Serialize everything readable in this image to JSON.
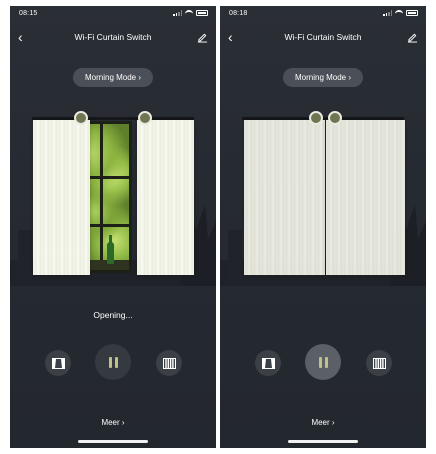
{
  "screens": [
    {
      "status_time": "08:15",
      "nav": {
        "back": "‹",
        "title": "Wi-Fi Curtain Switch"
      },
      "mode_button": "Morning Mode ›",
      "status_text": "Opening...",
      "curtain_state": "partially-open",
      "more_link": "Meer ›"
    },
    {
      "status_time": "08:18",
      "nav": {
        "back": "‹",
        "title": "Wi-Fi Curtain Switch"
      },
      "mode_button": "Morning Mode ›",
      "status_text": "",
      "curtain_state": "closed",
      "more_link": "Meer ›"
    }
  ],
  "icons": {
    "back": "chevron-left-icon",
    "edit": "edit-pencil-icon",
    "open": "curtain-open-icon",
    "pause": "pause-icon",
    "close": "curtain-close-icon"
  },
  "colors": {
    "background": "#262a31",
    "pause_accent": "#bfc08a",
    "knob": "#6f7453"
  }
}
